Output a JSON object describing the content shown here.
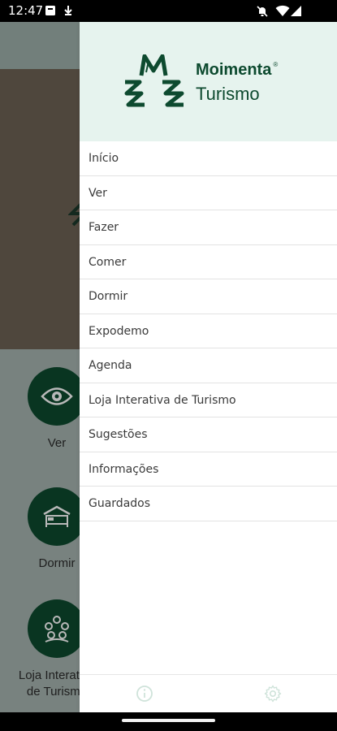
{
  "status_bar": {
    "time": "12:47",
    "icons": [
      "notification-icon",
      "download-icon",
      "mute-icon",
      "wifi-icon",
      "signal-icon"
    ]
  },
  "background": {
    "tiles": [
      {
        "label": "Ver",
        "icon": "eye-icon"
      },
      {
        "label": "Dormir",
        "icon": "bed-icon"
      },
      {
        "label": "Loja Interativa de Turismo",
        "icon": "people-icon"
      }
    ]
  },
  "drawer": {
    "brand": {
      "name": "Moimenta",
      "registered": "®",
      "subtitle": "Turismo"
    },
    "menu": [
      {
        "label": "Início"
      },
      {
        "label": "Ver"
      },
      {
        "label": "Fazer"
      },
      {
        "label": "Comer"
      },
      {
        "label": "Dormir"
      },
      {
        "label": "Expodemo"
      },
      {
        "label": "Agenda"
      },
      {
        "label": "Loja Interativa de Turismo"
      },
      {
        "label": "Sugestões"
      },
      {
        "label": "Informações"
      },
      {
        "label": "Guardados"
      }
    ],
    "footer": {
      "icons": [
        "info-icon",
        "settings-icon"
      ]
    }
  },
  "colors": {
    "brand_green": "#0d4a2f",
    "drawer_header_bg": "#e6f3ee",
    "footer_icon": "#cfe3da"
  }
}
